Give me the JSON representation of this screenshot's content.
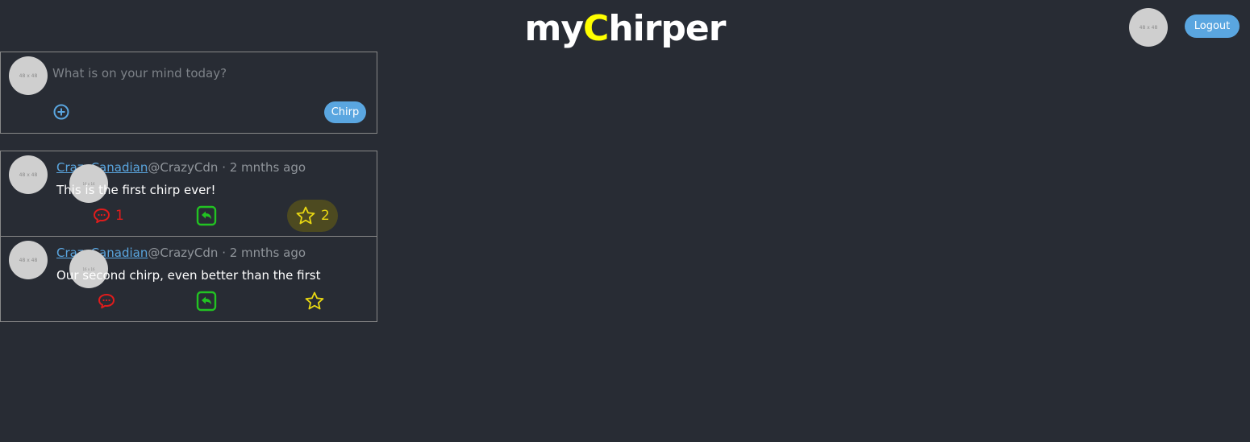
{
  "header": {
    "brand_prefix": "my",
    "brand_accent": "C",
    "brand_suffix": "hirper",
    "avatar_label": "48 x 48",
    "logout_label": "Logout"
  },
  "compose": {
    "avatar_label": "48 x 48",
    "placeholder": "What is on your mind today?",
    "chirp_label": "Chirp",
    "add_icon": "plus-circle-icon"
  },
  "chirps": [
    {
      "avatar_label": "48 x 48",
      "username": "CrazyCanadian",
      "badge_label": "16 x 16",
      "handle_time": "@CrazyCdn · 2 mnths ago",
      "text": "This is the first chirp ever!",
      "reply_count": "1",
      "favorite_count": "2",
      "favorited": true
    },
    {
      "avatar_label": "48 x 48",
      "username": "CrazyCanadian",
      "badge_label": "16 x 16",
      "handle_time": "@CrazyCdn · 2 mnths ago",
      "text": "Our second chirp, even better than the first",
      "reply_count": "",
      "favorite_count": "",
      "favorited": false
    }
  ],
  "colors": {
    "background": "#282c34",
    "accent_blue": "#5aa6e0",
    "brand_yellow": "#ffff00",
    "reply_red": "#e01c1c",
    "rechirp_green": "#22c322",
    "star_yellow": "#e8d712"
  },
  "icons": {
    "reply": "comment-bubble-icon",
    "rechirp": "rechirp-icon",
    "favorite": "star-icon"
  }
}
